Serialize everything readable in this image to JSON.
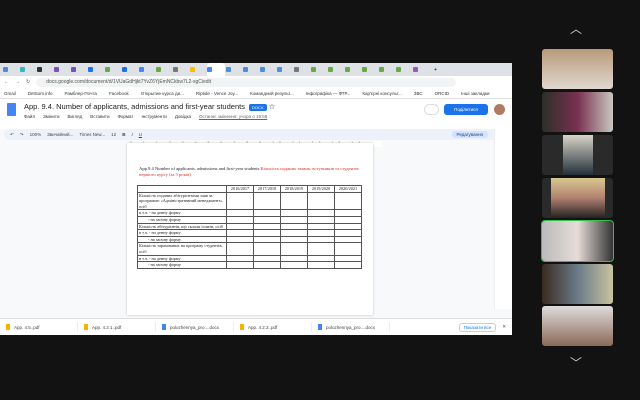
{
  "browser": {
    "url": "docs.google.com/document/d/1VUaGdHjkt7YvZ6YjEmNCkbw7L2-sgCiedit",
    "bookmarks": [
      "Gmail",
      "DetSom.info",
      "Рамблер-Почта",
      "Facebook",
      "Открытие курса ди...",
      "Riptide - Vence Joy...",
      "Командний результ...",
      "Інфографіка — ФТР...",
      "Кар'єрні консульт...",
      "ЗВС",
      "ORCID",
      "Інші закладки"
    ]
  },
  "doc": {
    "title": "App. 9.4. Number of applicants, admissions and first-year students",
    "badge": "DOCX",
    "menus": [
      "Файл",
      "Змінити",
      "Вигляд",
      "Вставити",
      "Формат",
      "Інструменти",
      "Довідка"
    ],
    "last_edit": "Останнє змінення: учора о 19:58",
    "share_label": "Поділитися",
    "toolbar": {
      "zoom": "100%",
      "style": "Звичайний...",
      "font": "Times New...",
      "size": "12",
      "mode": "Редагування"
    },
    "ruler": "2 1 1 2 3 4 5 6 7 8 9 10 11 12 13 14 15 16 18",
    "caption_en": "App.9.4    Number of applicants, admissions and first-year students",
    "caption_ua": "Кількість поданих заявок, вступників та студентів першого курсу (за 5 років)",
    "table": {
      "headers": [
        "2016/2017",
        "2017/2018",
        "2018/2019",
        "2019/2020",
        "2020/2021"
      ],
      "rows": [
        "Кількість поданих абітурієнтами заяв за програмою «Адміністративний менеджмент», осіб",
        "в т.ч. - на денну форму",
        "- на заочну форму",
        "Кількість абітурієнтів, що склали іспити, осіб",
        "в т.ч. - на денну форму",
        "- на заочну форму",
        "Кількість зарахованих на програму студентів, осіб",
        "в т.ч. - на денну форму",
        "- на заочну форму"
      ]
    }
  },
  "downloads": {
    "files": [
      "App. 4.5..pdf",
      "App. 4.2.1..pdf",
      "polozhennya_pro....docx",
      "App. 4.2.3..pdf",
      "polozhennya_pro....docx"
    ],
    "show_all": "Показати все"
  },
  "participants": [
    "participant-1",
    "participant-2",
    "participant-3",
    "participant-4",
    "participant-5",
    "participant-6",
    "participant-7"
  ]
}
